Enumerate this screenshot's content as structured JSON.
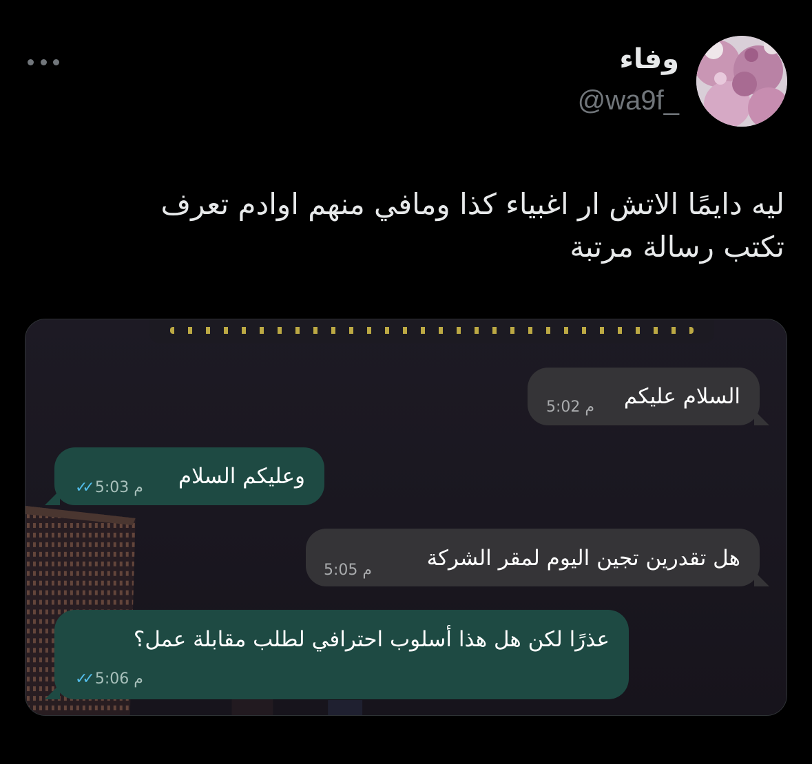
{
  "tweet": {
    "display_name": "وفاء",
    "handle": "@wa9f_",
    "more_icon": "more-horizontal-icon",
    "text_lines": [
      "ليه دايمًا الاتش ار اغبياء كذا ومافي منهم اوادم تعرف",
      "تكتب رسالة مرتبة"
    ]
  },
  "chat": {
    "messages": [
      {
        "direction": "incoming",
        "text": "السلام عليكم",
        "time": "5:02 م"
      },
      {
        "direction": "outgoing",
        "text": "وعليكم السلام",
        "time": "5:03 م",
        "status": "read"
      },
      {
        "direction": "incoming",
        "text": "هل تقدرين تجين اليوم لمقر الشركة",
        "time": "5:05 م"
      },
      {
        "direction": "outgoing",
        "text": "عذرًا لكن هل هذا أسلوب احترافي لطلب مقابلة عمل؟",
        "time": "5:06 م",
        "status": "read"
      }
    ],
    "colors": {
      "incoming_bubble": "#353437",
      "outgoing_bubble": "#1e4a43",
      "read_ticks": "#53bdeb"
    }
  }
}
